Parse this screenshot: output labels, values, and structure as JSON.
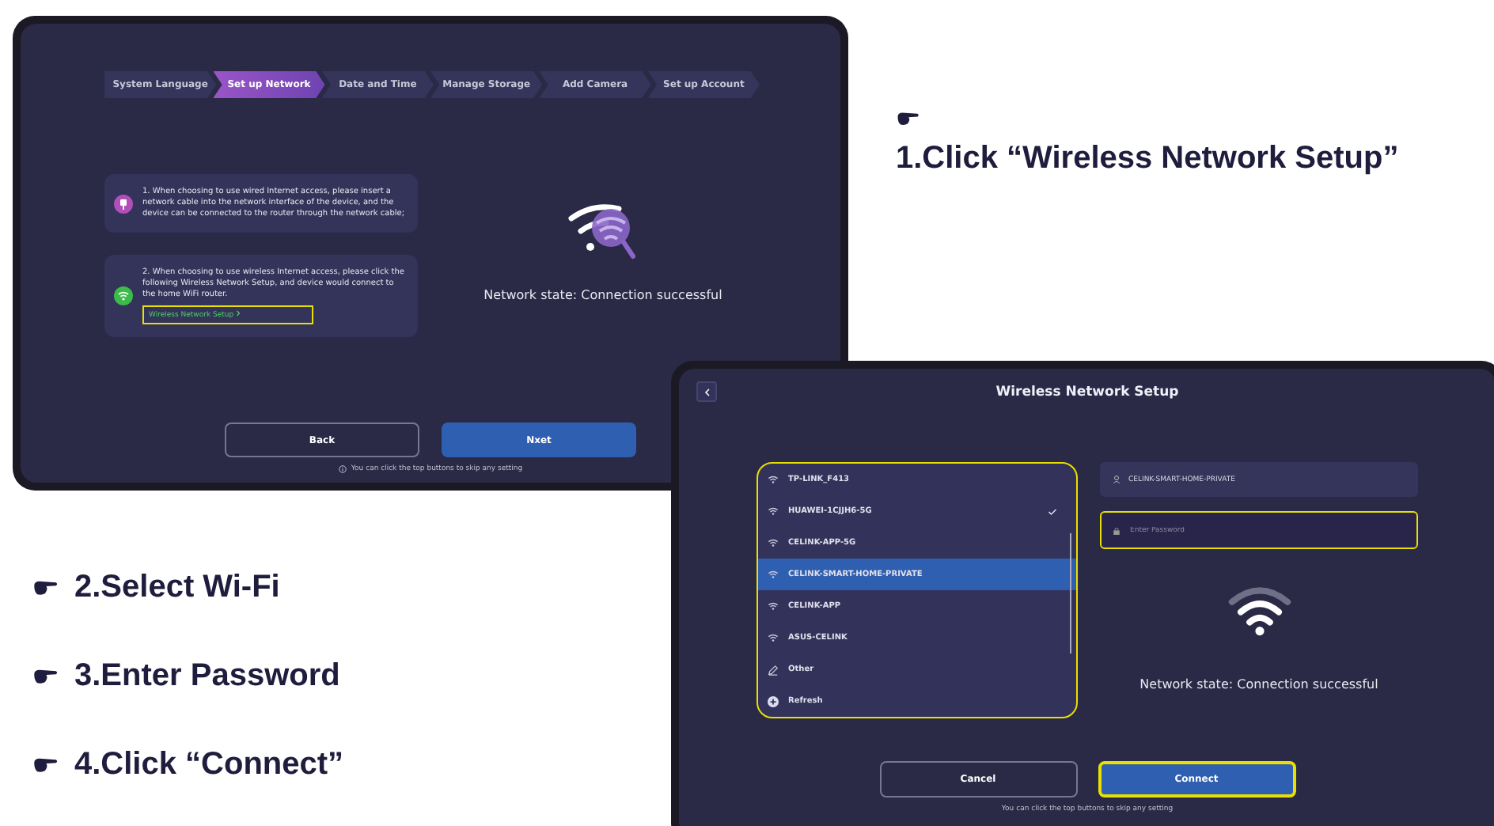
{
  "instructions": [
    {
      "text": "1.Click “Wireless Network Setup”"
    },
    {
      "text": "2.Select Wi-Fi"
    },
    {
      "text": "3.Enter Password"
    },
    {
      "text": "4.Click “Connect”"
    }
  ],
  "screen_1": {
    "steps": [
      {
        "label": "System Language",
        "selected": false
      },
      {
        "label": "Set up Network",
        "selected": true
      },
      {
        "label": "Date and Time",
        "selected": false
      },
      {
        "label": "Manage Storage",
        "selected": false
      },
      {
        "label": "Add Camera",
        "selected": false
      },
      {
        "label": "Set up Account",
        "selected": false
      }
    ],
    "options": [
      {
        "kind": "wired",
        "text": "1. When choosing to use wired Internet access, please insert a network cable into the network interface of the device, and the device can be connected to the router through the network cable;"
      },
      {
        "kind": "wireless",
        "text": "2. When choosing to use wireless Internet access, please click the following Wireless Network Setup, and device would connect to the home WiFi router.",
        "link": "Wireless Network Setup",
        "link_highlighted": true
      }
    ],
    "status": "Network state: Connection successful",
    "buttons": [
      {
        "label": "Back",
        "kind": "secondary",
        "highlighted": false
      },
      {
        "label": "Nxet",
        "kind": "primary",
        "highlighted": false
      }
    ],
    "hint": "You can click the top buttons to skip any setting"
  },
  "screen_2": {
    "title": "Wireless Network Setup",
    "list_highlighted": true,
    "networks": [
      {
        "kind": "wifi",
        "name": "TP-LINK_F413",
        "checked": false,
        "selected": false
      },
      {
        "kind": "wifi",
        "name": "HUAWEI-1CJJH6-5G",
        "checked": true,
        "selected": false
      },
      {
        "kind": "wifi",
        "name": "CELINK-APP-5G",
        "checked": false,
        "selected": false
      },
      {
        "kind": "wifi",
        "name": "CELINK-SMART-HOME-PRIVATE",
        "checked": false,
        "selected": true
      },
      {
        "kind": "wifi",
        "name": "CELINK-APP",
        "checked": false,
        "selected": false
      },
      {
        "kind": "wifi",
        "name": "ASUS-CELINK",
        "checked": false,
        "selected": false
      },
      {
        "kind": "other",
        "name": "Other",
        "checked": false,
        "selected": false
      },
      {
        "kind": "refresh",
        "name": "Refresh",
        "checked": false,
        "selected": false
      }
    ],
    "network_field": {
      "value": "CELINK-SMART-HOME-PRIVATE",
      "highlighted": false
    },
    "password_field": {
      "placeholder": "Enter Password",
      "highlighted": true
    },
    "status": "Network state: Connection successful",
    "buttons": [
      {
        "label": "Cancel",
        "kind": "secondary",
        "highlighted": false
      },
      {
        "label": "Connect",
        "kind": "primary",
        "highlighted": true
      }
    ],
    "hint": "You can click the top buttons to skip any setting"
  }
}
